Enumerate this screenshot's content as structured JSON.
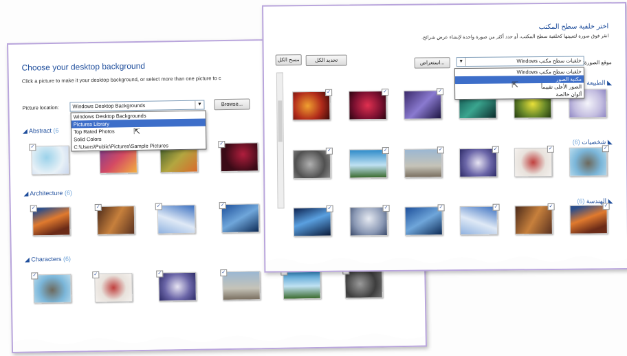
{
  "english_panel": {
    "title": "Choose your desktop background",
    "subtitle": "Click a picture to make it your desktop background, or select more than one picture to c",
    "location_label": "Picture location:",
    "location_value": "Windows Desktop Backgrounds",
    "browse_label": "Browse...",
    "dropdown_options": [
      "Windows Desktop Backgrounds",
      "Pictures Library",
      "Top Rated Photos",
      "Solid Colors",
      "C:\\Users\\Public\\Pictures\\Sample Pictures"
    ],
    "selected_option_index": 1,
    "groups": [
      {
        "name": "Abstract",
        "count": "(6"
      },
      {
        "name": "Architecture",
        "count": "(6)"
      },
      {
        "name": "Characters",
        "count": "(6)"
      }
    ]
  },
  "arabic_panel": {
    "title": "اختر خلفية سطح المكتب",
    "subtitle": "انقر فوق صورة لتعيينها كخلفية سطح المكتب، أو حدد أكثر من صورة واحدة لإنشاء عرض شرائح.",
    "location_label": "موقع الصورة:",
    "location_value": "خلفيات سطح مكتب Windows",
    "browse_label": "استعراض...",
    "select_all_label": "تحديد الكل",
    "clear_all_label": "مسح الكل",
    "dropdown_options": [
      "خلفيات سطح مكتب Windows",
      "مكتبة الصور",
      "الصور الأعلى تقييماً",
      "ألوان خالصة"
    ],
    "groups": [
      {
        "name": "الطبيعة",
        "count": "(6)"
      },
      {
        "name": "شخصيات",
        "count": "(6)"
      },
      {
        "name": "الهندسة",
        "count": "(6)"
      }
    ]
  },
  "colors": {
    "accent_blue": "#1f4e9c",
    "panel_border": "#b9a5dc",
    "selection": "#3d6ec9"
  }
}
